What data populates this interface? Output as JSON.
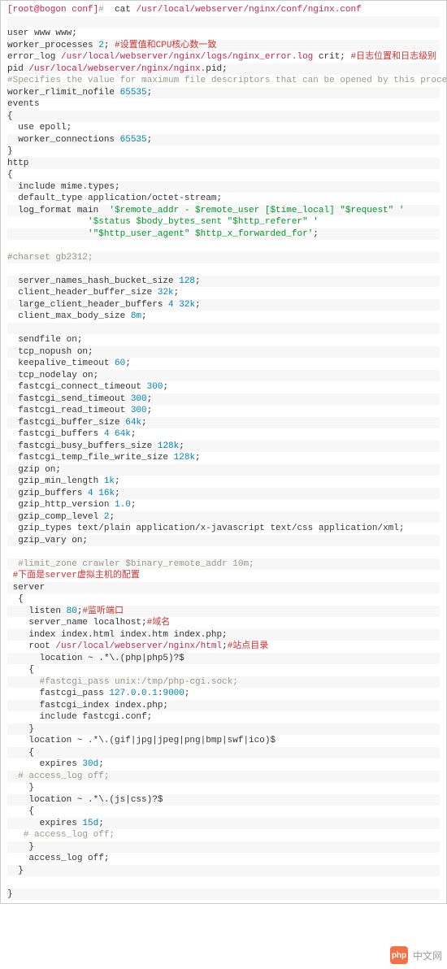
{
  "watermark": {
    "icon_text": "php",
    "label": "中文网"
  },
  "lines": [
    [
      {
        "c": "shell",
        "t": "[root@bogon conf]"
      },
      {
        "c": "cmt",
        "t": "# "
      },
      {
        "c": "plain",
        "t": " cat "
      },
      {
        "c": "dir",
        "t": "/usr/"
      },
      {
        "c": "kw",
        "t": "local"
      },
      {
        "c": "dir",
        "t": "/webserver/nginx/conf/nginx.conf"
      }
    ],
    [
      {
        "c": "plain",
        "t": " "
      }
    ],
    [
      {
        "c": "plain",
        "t": "user www www;"
      }
    ],
    [
      {
        "c": "plain",
        "t": "worker_processes "
      },
      {
        "c": "num",
        "t": "2"
      },
      {
        "c": "plain",
        "t": "; "
      },
      {
        "c": "zh",
        "t": "#设置值和CPU核心数一致"
      }
    ],
    [
      {
        "c": "plain",
        "t": "error_log "
      },
      {
        "c": "dir",
        "t": "/usr/"
      },
      {
        "c": "kw",
        "t": "local"
      },
      {
        "c": "dir",
        "t": "/webserver/nginx/logs/nginx_error.log"
      },
      {
        "c": "plain",
        "t": " crit; "
      },
      {
        "c": "zh",
        "t": "#日志位置和日志级别"
      }
    ],
    [
      {
        "c": "plain",
        "t": "pid "
      },
      {
        "c": "dir",
        "t": "/usr/"
      },
      {
        "c": "kw",
        "t": "local"
      },
      {
        "c": "dir",
        "t": "/webserver/nginx/nginx."
      },
      {
        "c": "plain",
        "t": "pid;"
      }
    ],
    [
      {
        "c": "cmt",
        "t": "#Specifies the value for maximum file descriptors that can be opened by this process."
      }
    ],
    [
      {
        "c": "plain",
        "t": "worker_rlimit_nofile "
      },
      {
        "c": "num",
        "t": "65535"
      },
      {
        "c": "plain",
        "t": ";"
      }
    ],
    [
      {
        "c": "plain",
        "t": "events"
      }
    ],
    [
      {
        "c": "plain",
        "t": "{"
      }
    ],
    [
      {
        "c": "plain",
        "t": "  use epoll;"
      }
    ],
    [
      {
        "c": "plain",
        "t": "  worker_connections "
      },
      {
        "c": "num",
        "t": "65535"
      },
      {
        "c": "plain",
        "t": ";"
      }
    ],
    [
      {
        "c": "plain",
        "t": "}"
      }
    ],
    [
      {
        "c": "plain",
        "t": "http"
      }
    ],
    [
      {
        "c": "plain",
        "t": "{"
      }
    ],
    [
      {
        "c": "plain",
        "t": "  include mime.types;"
      }
    ],
    [
      {
        "c": "plain",
        "t": "  default_type application/octet-stream;"
      }
    ],
    [
      {
        "c": "plain",
        "t": "  log_format main  "
      },
      {
        "c": "str",
        "t": "'$remote_addr - $remote_user [$time_local] \"$request\" '"
      }
    ],
    [
      {
        "c": "plain",
        "t": "               "
      },
      {
        "c": "str",
        "t": "'$status $body_bytes_sent \"$http_referer\" '"
      }
    ],
    [
      {
        "c": "plain",
        "t": "               "
      },
      {
        "c": "str",
        "t": "'\"$http_user_agent\" $http_x_forwarded_for'"
      },
      {
        "c": "plain",
        "t": ";"
      }
    ],
    [
      {
        "c": "plain",
        "t": "   "
      }
    ],
    [
      {
        "c": "cmt",
        "t": "#charset gb2312;"
      }
    ],
    [
      {
        "c": "plain",
        "t": "   "
      }
    ],
    [
      {
        "c": "plain",
        "t": "  server_names_hash_bucket_size "
      },
      {
        "c": "num",
        "t": "128"
      },
      {
        "c": "plain",
        "t": ";"
      }
    ],
    [
      {
        "c": "plain",
        "t": "  client_header_buffer_size "
      },
      {
        "c": "num",
        "t": "32k"
      },
      {
        "c": "plain",
        "t": ";"
      }
    ],
    [
      {
        "c": "plain",
        "t": "  large_client_header_buffers "
      },
      {
        "c": "num",
        "t": "4"
      },
      {
        "c": "plain",
        "t": " "
      },
      {
        "c": "num",
        "t": "32k"
      },
      {
        "c": "plain",
        "t": ";"
      }
    ],
    [
      {
        "c": "plain",
        "t": "  client_max_body_size "
      },
      {
        "c": "num",
        "t": "8m"
      },
      {
        "c": "plain",
        "t": ";"
      }
    ],
    [
      {
        "c": "plain",
        "t": "   "
      }
    ],
    [
      {
        "c": "plain",
        "t": "  sendfile on;"
      }
    ],
    [
      {
        "c": "plain",
        "t": "  tcp_nopush on;"
      }
    ],
    [
      {
        "c": "plain",
        "t": "  keepalive_timeout "
      },
      {
        "c": "num",
        "t": "60"
      },
      {
        "c": "plain",
        "t": ";"
      }
    ],
    [
      {
        "c": "plain",
        "t": "  tcp_nodelay on;"
      }
    ],
    [
      {
        "c": "plain",
        "t": "  fastcgi_connect_timeout "
      },
      {
        "c": "num",
        "t": "300"
      },
      {
        "c": "plain",
        "t": ";"
      }
    ],
    [
      {
        "c": "plain",
        "t": "  fastcgi_send_timeout "
      },
      {
        "c": "num",
        "t": "300"
      },
      {
        "c": "plain",
        "t": ";"
      }
    ],
    [
      {
        "c": "plain",
        "t": "  fastcgi_read_timeout "
      },
      {
        "c": "num",
        "t": "300"
      },
      {
        "c": "plain",
        "t": ";"
      }
    ],
    [
      {
        "c": "plain",
        "t": "  fastcgi_buffer_size "
      },
      {
        "c": "num",
        "t": "64k"
      },
      {
        "c": "plain",
        "t": ";"
      }
    ],
    [
      {
        "c": "plain",
        "t": "  fastcgi_buffers "
      },
      {
        "c": "num",
        "t": "4"
      },
      {
        "c": "plain",
        "t": " "
      },
      {
        "c": "num",
        "t": "64k"
      },
      {
        "c": "plain",
        "t": ";"
      }
    ],
    [
      {
        "c": "plain",
        "t": "  fastcgi_busy_buffers_size "
      },
      {
        "c": "num",
        "t": "128k"
      },
      {
        "c": "plain",
        "t": ";"
      }
    ],
    [
      {
        "c": "plain",
        "t": "  fastcgi_temp_file_write_size "
      },
      {
        "c": "num",
        "t": "128k"
      },
      {
        "c": "plain",
        "t": ";"
      }
    ],
    [
      {
        "c": "plain",
        "t": "  gzip on; "
      }
    ],
    [
      {
        "c": "plain",
        "t": "  gzip_min_length "
      },
      {
        "c": "num",
        "t": "1k"
      },
      {
        "c": "plain",
        "t": ";"
      }
    ],
    [
      {
        "c": "plain",
        "t": "  gzip_buffers "
      },
      {
        "c": "num",
        "t": "4"
      },
      {
        "c": "plain",
        "t": " "
      },
      {
        "c": "num",
        "t": "16k"
      },
      {
        "c": "plain",
        "t": ";"
      }
    ],
    [
      {
        "c": "plain",
        "t": "  gzip_http_version "
      },
      {
        "c": "num",
        "t": "1.0"
      },
      {
        "c": "plain",
        "t": ";"
      }
    ],
    [
      {
        "c": "plain",
        "t": "  gzip_comp_level "
      },
      {
        "c": "num",
        "t": "2"
      },
      {
        "c": "plain",
        "t": ";"
      }
    ],
    [
      {
        "c": "plain",
        "t": "  gzip_types text/plain application/x-javascript text/css application/xml;"
      }
    ],
    [
      {
        "c": "plain",
        "t": "  gzip_vary on;"
      }
    ],
    [
      {
        "c": "plain",
        "t": "  "
      }
    ],
    [
      {
        "c": "plain",
        "t": "  "
      },
      {
        "c": "cmt",
        "t": "#limit_zone crawler $binary_remote_addr 10m;"
      }
    ],
    [
      {
        "c": "plain",
        "t": " "
      },
      {
        "c": "zh",
        "t": "#下面是server虚拟主机的配置"
      }
    ],
    [
      {
        "c": "plain",
        "t": " server"
      }
    ],
    [
      {
        "c": "plain",
        "t": "  {"
      }
    ],
    [
      {
        "c": "plain",
        "t": "    listen "
      },
      {
        "c": "num",
        "t": "80"
      },
      {
        "c": "plain",
        "t": ";"
      },
      {
        "c": "zh",
        "t": "#监听端口"
      }
    ],
    [
      {
        "c": "plain",
        "t": "    server_name localhost;"
      },
      {
        "c": "zh",
        "t": "#域名"
      }
    ],
    [
      {
        "c": "plain",
        "t": "    index index.html index.htm index.php;"
      }
    ],
    [
      {
        "c": "plain",
        "t": "    root "
      },
      {
        "c": "dir",
        "t": "/usr/"
      },
      {
        "c": "kw",
        "t": "local"
      },
      {
        "c": "dir",
        "t": "/webserver/nginx/html"
      },
      {
        "c": "plain",
        "t": ";"
      },
      {
        "c": "zh",
        "t": "#站点目录"
      }
    ],
    [
      {
        "c": "plain",
        "t": "      location ~ .*\\.(php|php5)?$"
      }
    ],
    [
      {
        "c": "plain",
        "t": "    {"
      }
    ],
    [
      {
        "c": "plain",
        "t": "      "
      },
      {
        "c": "cmt",
        "t": "#fastcgi_pass unix:/tmp/php-cgi.sock;"
      }
    ],
    [
      {
        "c": "plain",
        "t": "      fastcgi_pass "
      },
      {
        "c": "num",
        "t": "127.0"
      },
      {
        "c": "plain",
        "t": "."
      },
      {
        "c": "num",
        "t": "0.1"
      },
      {
        "c": "plain",
        "t": ":"
      },
      {
        "c": "num",
        "t": "9000"
      },
      {
        "c": "plain",
        "t": ";"
      }
    ],
    [
      {
        "c": "plain",
        "t": "      fastcgi_index index.php;"
      }
    ],
    [
      {
        "c": "plain",
        "t": "      include fastcgi.conf;"
      }
    ],
    [
      {
        "c": "plain",
        "t": "    }"
      }
    ],
    [
      {
        "c": "plain",
        "t": "    location ~ .*\\.(gif|jpg|jpeg|png|bmp|swf|ico)$"
      }
    ],
    [
      {
        "c": "plain",
        "t": "    {"
      }
    ],
    [
      {
        "c": "plain",
        "t": "      expires "
      },
      {
        "c": "num",
        "t": "30d"
      },
      {
        "c": "plain",
        "t": ";"
      }
    ],
    [
      {
        "c": "plain",
        "t": "  "
      },
      {
        "c": "cmt",
        "t": "# access_log off;"
      }
    ],
    [
      {
        "c": "plain",
        "t": "    }"
      }
    ],
    [
      {
        "c": "plain",
        "t": "    location ~ .*\\.(js|css)?$"
      }
    ],
    [
      {
        "c": "plain",
        "t": "    {"
      }
    ],
    [
      {
        "c": "plain",
        "t": "      expires "
      },
      {
        "c": "num",
        "t": "15d"
      },
      {
        "c": "plain",
        "t": ";"
      }
    ],
    [
      {
        "c": "plain",
        "t": "   "
      },
      {
        "c": "cmt",
        "t": "# access_log off;"
      }
    ],
    [
      {
        "c": "plain",
        "t": "    }"
      }
    ],
    [
      {
        "c": "plain",
        "t": "    access_log off;"
      }
    ],
    [
      {
        "c": "plain",
        "t": "  }"
      }
    ],
    [
      {
        "c": "plain",
        "t": " "
      }
    ],
    [
      {
        "c": "plain",
        "t": "}"
      }
    ]
  ]
}
